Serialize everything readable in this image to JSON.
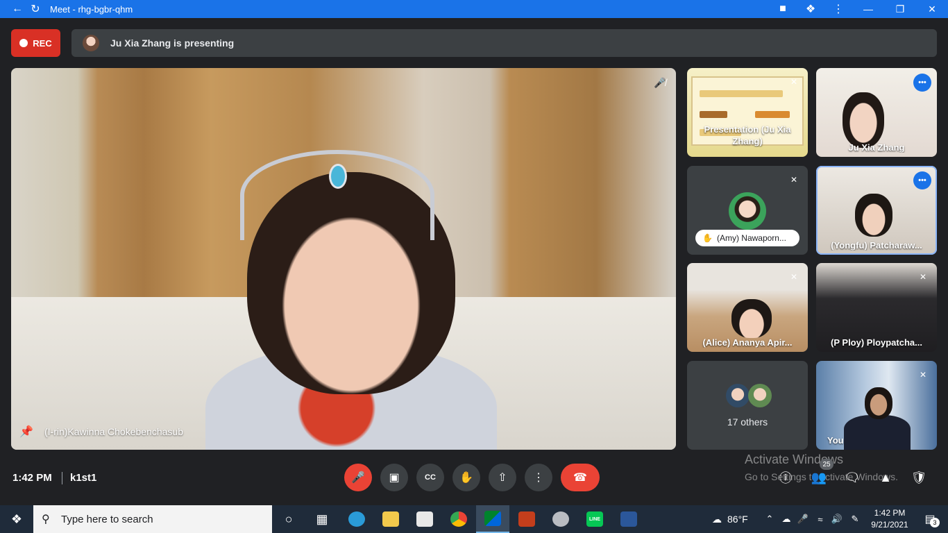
{
  "window": {
    "title": "Meet - rhg-bgbr-qhm",
    "accent": "#1a73e8"
  },
  "banner": {
    "rec_label": "REC",
    "presenting_text": "Ju Xia Zhang is presenting"
  },
  "main_tile": {
    "participant_name": "(I-rin)Kawinna Chokebenchasub",
    "muted": true,
    "pinned": true
  },
  "tiles": [
    {
      "name": "Presentation (Ju Xia Zhang)",
      "muted": true
    },
    {
      "name": "Ju Xia Zhang",
      "speaking": true
    },
    {
      "name": "(Amy) Nawaporn...",
      "muted": true,
      "hand_raised": true
    },
    {
      "name": "(Yongfu) Patcharaw...",
      "speaking": true,
      "active": true
    },
    {
      "name": "(Alice) Ananya Apir...",
      "muted": true
    },
    {
      "name": "(P Ploy) Ploypatcha...",
      "muted": true
    },
    {
      "others_label": "17 others"
    },
    {
      "name": "You",
      "muted": true
    }
  ],
  "watermark": {
    "title": "Activate Windows",
    "subtitle": "Go to Settings to activate Windows."
  },
  "footer": {
    "time": "1:42 PM",
    "meeting_code": "k1st1",
    "participants_count": "25",
    "end_call_color": "#ea4335"
  },
  "taskbar": {
    "search_placeholder": "Type here to search",
    "weather": "86°F",
    "clock_time": "1:42 PM",
    "clock_date": "9/21/2021",
    "notifications": "3",
    "line_label": "LINE"
  }
}
